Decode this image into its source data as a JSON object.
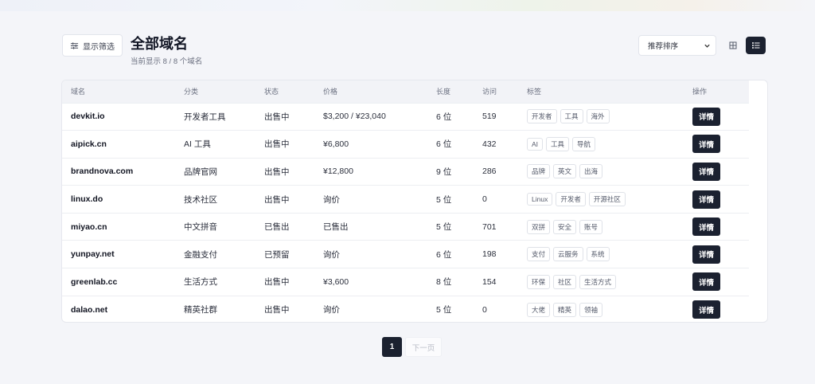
{
  "header": {
    "filter_label": "显示筛选",
    "title": "全部域名",
    "subtitle": "当前显示 8 / 8 个域名",
    "sort_value": "推荐排序"
  },
  "table": {
    "columns": [
      "域名",
      "分类",
      "状态",
      "价格",
      "长度",
      "访问",
      "标签",
      "操作"
    ],
    "rows": [
      {
        "domain": "devkit.io",
        "category": "开发者工具",
        "status": "出售中",
        "price": "$3,200 / ¥23,040",
        "length": "6 位",
        "visits": "519",
        "tags": [
          "开发者",
          "工具",
          "海外"
        ],
        "action": "详情"
      },
      {
        "domain": "aipick.cn",
        "category": "AI 工具",
        "status": "出售中",
        "price": "¥6,800",
        "length": "6 位",
        "visits": "432",
        "tags": [
          "AI",
          "工具",
          "导航"
        ],
        "action": "详情"
      },
      {
        "domain": "brandnova.com",
        "category": "品牌官网",
        "status": "出售中",
        "price": "¥12,800",
        "length": "9 位",
        "visits": "286",
        "tags": [
          "品牌",
          "英文",
          "出海"
        ],
        "action": "详情"
      },
      {
        "domain": "linux.do",
        "category": "技术社区",
        "status": "出售中",
        "price": "询价",
        "length": "5 位",
        "visits": "0",
        "tags": [
          "Linux",
          "开发者",
          "开源社区"
        ],
        "action": "详情"
      },
      {
        "domain": "miyao.cn",
        "category": "中文拼音",
        "status": "已售出",
        "price": "已售出",
        "length": "5 位",
        "visits": "701",
        "tags": [
          "双拼",
          "安全",
          "账号"
        ],
        "action": "详情"
      },
      {
        "domain": "yunpay.net",
        "category": "金融支付",
        "status": "已预留",
        "price": "询价",
        "length": "6 位",
        "visits": "198",
        "tags": [
          "支付",
          "云服务",
          "系统"
        ],
        "action": "详情"
      },
      {
        "domain": "greenlab.cc",
        "category": "生活方式",
        "status": "出售中",
        "price": "¥3,600",
        "length": "8 位",
        "visits": "154",
        "tags": [
          "环保",
          "社区",
          "生活方式"
        ],
        "action": "详情"
      },
      {
        "domain": "dalao.net",
        "category": "精英社群",
        "status": "出售中",
        "price": "询价",
        "length": "5 位",
        "visits": "0",
        "tags": [
          "大佬",
          "精英",
          "领袖"
        ],
        "action": "详情"
      }
    ]
  },
  "pagination": {
    "current": "1",
    "next_label": "下一页"
  },
  "icons": {
    "filter": "sliders-icon",
    "sort_dropdown": "chevron-down-icon",
    "grid_view": "grid-icon",
    "list_view": "list-icon"
  },
  "colors": {
    "accent_dark": "#1b2130",
    "background": "#f4f5f9"
  }
}
